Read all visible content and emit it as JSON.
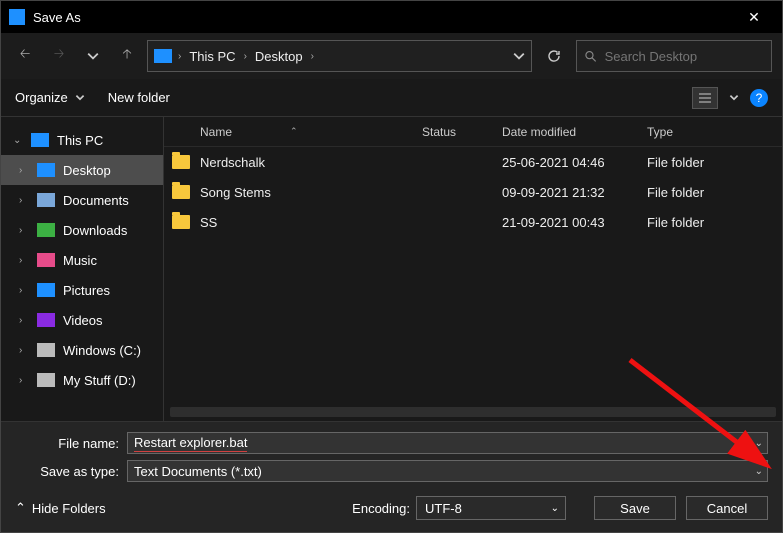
{
  "title": "Save As",
  "breadcrumb": [
    "This PC",
    "Desktop"
  ],
  "search_placeholder": "Search Desktop",
  "toolbar": {
    "organize": "Organize",
    "newfolder": "New folder"
  },
  "sidebar": {
    "root": "This PC",
    "items": [
      {
        "label": "Desktop",
        "icon": "#1e90ff",
        "selected": true
      },
      {
        "label": "Documents",
        "icon": "#7aa7d9",
        "selected": false
      },
      {
        "label": "Downloads",
        "icon": "#3cb043",
        "selected": false
      },
      {
        "label": "Music",
        "icon": "#e74c8a",
        "selected": false
      },
      {
        "label": "Pictures",
        "icon": "#1e90ff",
        "selected": false
      },
      {
        "label": "Videos",
        "icon": "#8a2be2",
        "selected": false
      },
      {
        "label": "Windows (C:)",
        "icon": "#bbbbbb",
        "selected": false
      },
      {
        "label": "My Stuff (D:)",
        "icon": "#bbbbbb",
        "selected": false
      }
    ]
  },
  "columns": {
    "name": "Name",
    "status": "Status",
    "date": "Date modified",
    "type": "Type"
  },
  "files": [
    {
      "name": "Nerdschalk",
      "date": "25-06-2021 04:46",
      "type": "File folder"
    },
    {
      "name": "Song Stems",
      "date": "09-09-2021 21:32",
      "type": "File folder"
    },
    {
      "name": "SS",
      "date": "21-09-2021 00:43",
      "type": "File folder"
    }
  ],
  "form": {
    "filename_label": "File name:",
    "filename_value": "Restart explorer.bat",
    "saveas_label": "Save as type:",
    "saveas_value": "Text Documents (*.txt)"
  },
  "footer": {
    "hide": "Hide Folders",
    "encoding_label": "Encoding:",
    "encoding_value": "UTF-8",
    "save": "Save",
    "cancel": "Cancel"
  }
}
